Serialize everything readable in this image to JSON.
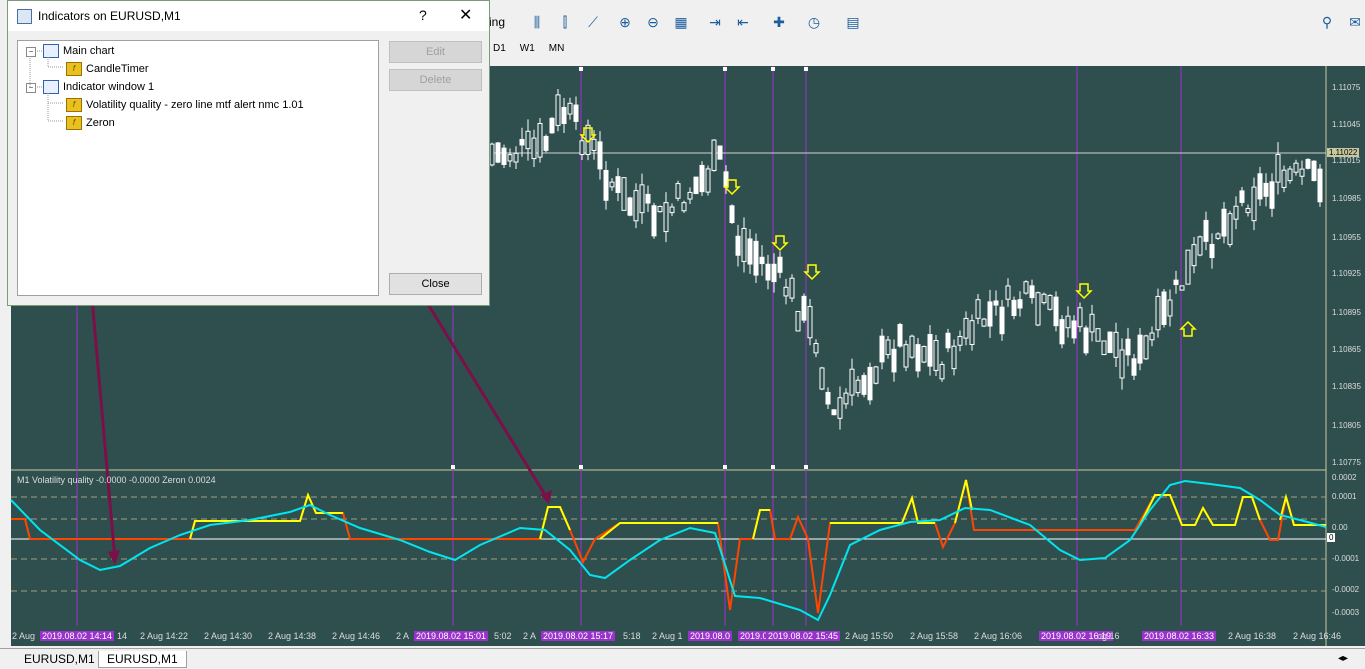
{
  "dialog": {
    "title": "Indicators on EURUSD,M1",
    "help": "?",
    "close_glyph": "✕",
    "tree": [
      {
        "label": "Main chart",
        "type": "window"
      },
      {
        "label": "CandleTimer",
        "type": "indicator"
      },
      {
        "label": "Indicator window 1",
        "type": "window"
      },
      {
        "label": "Volatility quality - zero line mtf alert nmc 1.01",
        "type": "indicator"
      },
      {
        "label": "Zeron",
        "type": "indicator"
      }
    ],
    "buttons": {
      "edit": "Edit",
      "delete": "Delete",
      "close": "Close"
    }
  },
  "toolbar": {
    "partial_label": "ing",
    "timeframes": [
      "D1",
      "W1",
      "MN"
    ]
  },
  "chart": {
    "price_labels": [
      "1.11075",
      "1.11045",
      "1.11022",
      "1.11015",
      "1.10985",
      "1.10955",
      "1.10925",
      "1.10895",
      "1.10865",
      "1.10835",
      "1.10805",
      "1.10775"
    ],
    "current_price": "1.11022",
    "indicator_label": "M1 Volatility quality -0.0000 -0.0000  Zeron 0.0024",
    "indicator_scale": [
      "0.0002",
      "0.0001",
      "0.00",
      "-0.0001",
      "-0.0002",
      "-0.0003"
    ],
    "indicator_current": "0",
    "time_labels": [
      "2 Aug",
      "2019.08.02 14:14",
      "14",
      "2 Aug 14:22",
      "2 Aug 14:30",
      "2 Aug 14:38",
      "2 Aug 14:46",
      "2 A",
      "2019.08.02 15:01",
      "5:02",
      "2 A",
      "2019.08.02 15:17",
      "5:18",
      "2 Aug 1",
      "2019.08.0",
      "2019.0",
      "2019.08.02 15:45",
      "2 Aug 15:50",
      "2 Aug 15:58",
      "2 Aug 16:06",
      "2019.08.02 16:19",
      "ug 16",
      "2019.08.02 16:33",
      "2 Aug 16:38",
      "2 Aug 16:46"
    ]
  },
  "tabs": [
    "EURUSD,M1",
    "EURUSD,M1"
  ],
  "colors": {
    "chart_bg": "#2f4f4f",
    "vq_up": "#ffff00",
    "vq_down": "#ff4500",
    "zeron": "#00e5ee",
    "arrow": "#7b1048",
    "vline": "#9932cc"
  }
}
